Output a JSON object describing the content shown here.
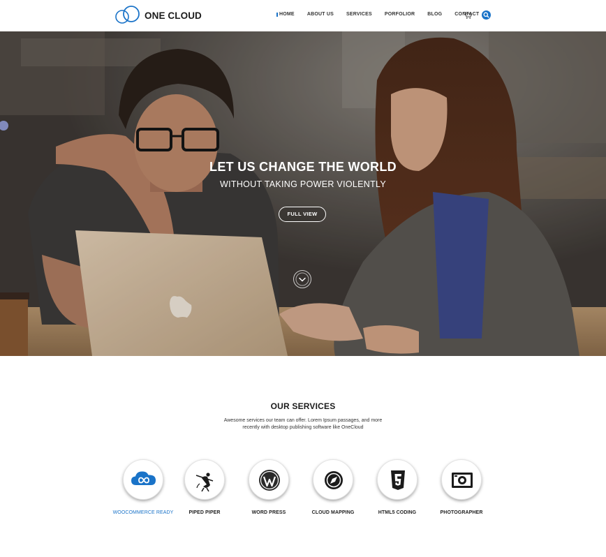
{
  "header": {
    "logo_text": "ONE CLOUD",
    "logo_icon": "double-ring-logo",
    "nav": [
      {
        "label": "HOME",
        "active": true
      },
      {
        "label": "ABOUT US",
        "active": false
      },
      {
        "label": "SERVICES",
        "active": false
      },
      {
        "label": "PORFOLIOR",
        "active": false
      },
      {
        "label": "BLOG",
        "active": false
      },
      {
        "label": "CONTACT",
        "active": false
      }
    ],
    "cart_icon": "cart-icon",
    "search_icon": "search-icon"
  },
  "hero": {
    "title": "LET US CHANGE THE WORLD",
    "subtitle": "WITHOUT TAKING POWER VIOLENTLY",
    "button": "FULL VIEW",
    "scroll_icon": "chevron-down-icon"
  },
  "services": {
    "title": "OUR SERVICES",
    "description": "Awesome services our team can offer. Lorem Ipsum passages, and more recently with desktop publishing software like OneCloud",
    "items": [
      {
        "label": "WOOCOMMERCE READY",
        "icon": "cloud-infinity-icon",
        "highlight": true
      },
      {
        "label": "PIPED PIPER",
        "icon": "piper-icon",
        "highlight": false
      },
      {
        "label": "WORD PRESS",
        "icon": "wordpress-icon",
        "highlight": false
      },
      {
        "label": "CLOUD MAPPING",
        "icon": "compass-icon",
        "highlight": false
      },
      {
        "label": "HTML5 CODING",
        "icon": "html5-icon",
        "highlight": false
      },
      {
        "label": "PHOTOGRAPHER",
        "icon": "camera-icon",
        "highlight": false
      }
    ]
  },
  "colors": {
    "accent": "#1a73c8",
    "text": "#222222"
  }
}
